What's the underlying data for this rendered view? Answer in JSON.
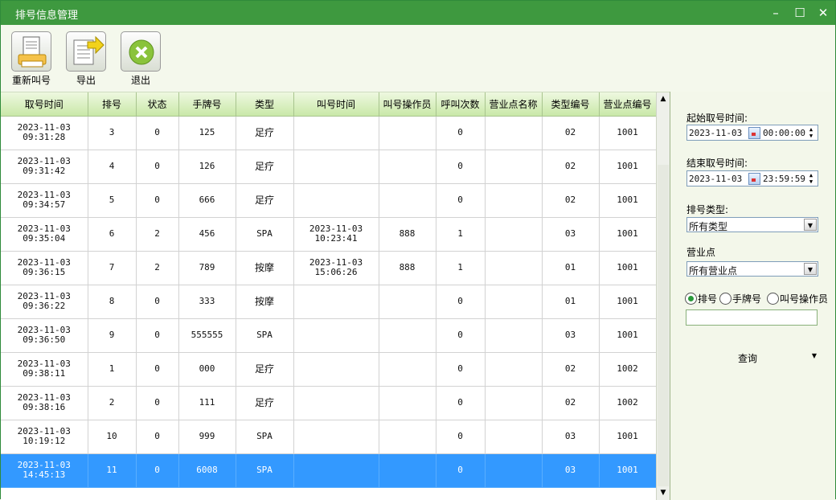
{
  "window": {
    "title": "排号信息管理",
    "minimize": "–",
    "maximize": "☐",
    "close": "✕"
  },
  "toolbar": {
    "recall_label": "重新叫号",
    "export_label": "导出",
    "exit_label": "退出"
  },
  "grid": {
    "columns": [
      "取号时间",
      "排号",
      "状态",
      "手牌号",
      "类型",
      "叫号时间",
      "叫号操作员",
      "呼叫次数",
      "营业点名称",
      "类型编号",
      "营业点编号"
    ],
    "rows": [
      [
        "2023-11-03\n09:31:28",
        "3",
        "0",
        "125",
        "足疗",
        "",
        "",
        "0",
        "",
        "02",
        "1001"
      ],
      [
        "2023-11-03\n09:31:42",
        "4",
        "0",
        "126",
        "足疗",
        "",
        "",
        "0",
        "",
        "02",
        "1001"
      ],
      [
        "2023-11-03\n09:34:57",
        "5",
        "0",
        "666",
        "足疗",
        "",
        "",
        "0",
        "",
        "02",
        "1001"
      ],
      [
        "2023-11-03\n09:35:04",
        "6",
        "2",
        "456",
        "SPA",
        "2023-11-03\n10:23:41",
        "888",
        "1",
        "",
        "03",
        "1001"
      ],
      [
        "2023-11-03\n09:36:15",
        "7",
        "2",
        "789",
        "按摩",
        "2023-11-03\n15:06:26",
        "888",
        "1",
        "",
        "01",
        "1001"
      ],
      [
        "2023-11-03\n09:36:22",
        "8",
        "0",
        "333",
        "按摩",
        "",
        "",
        "0",
        "",
        "01",
        "1001"
      ],
      [
        "2023-11-03\n09:36:50",
        "9",
        "0",
        "555555",
        "SPA",
        "",
        "",
        "0",
        "",
        "03",
        "1001"
      ],
      [
        "2023-11-03\n09:38:11",
        "1",
        "0",
        "000",
        "足疗",
        "",
        "",
        "0",
        "",
        "02",
        "1002"
      ],
      [
        "2023-11-03\n09:38:16",
        "2",
        "0",
        "111",
        "足疗",
        "",
        "",
        "0",
        "",
        "02",
        "1002"
      ],
      [
        "2023-11-03\n10:19:12",
        "10",
        "0",
        "999",
        "SPA",
        "",
        "",
        "0",
        "",
        "03",
        "1001"
      ],
      [
        "2023-11-03\n14:45:13",
        "11",
        "0",
        "6008",
        "SPA",
        "",
        "",
        "0",
        "",
        "03",
        "1001"
      ]
    ],
    "selected_row": 10
  },
  "filters": {
    "start_label": "起始取号时间:",
    "start_date": "2023-11-03",
    "start_time": "00:00:00",
    "end_label": "结束取号时间:",
    "end_date": "2023-11-03",
    "end_time": "23:59:59",
    "type_label": "排号类型:",
    "type_value": "所有类型",
    "site_label": "营业点",
    "site_value": "所有营业点",
    "radio_queue": "排号",
    "radio_hand": "手牌号",
    "radio_operator": "叫号操作员",
    "keyword": "",
    "query_label": "查询"
  },
  "colors": {
    "titlebar": "#3e993f",
    "header": "#c9e8a8",
    "selection": "#3399ff"
  }
}
